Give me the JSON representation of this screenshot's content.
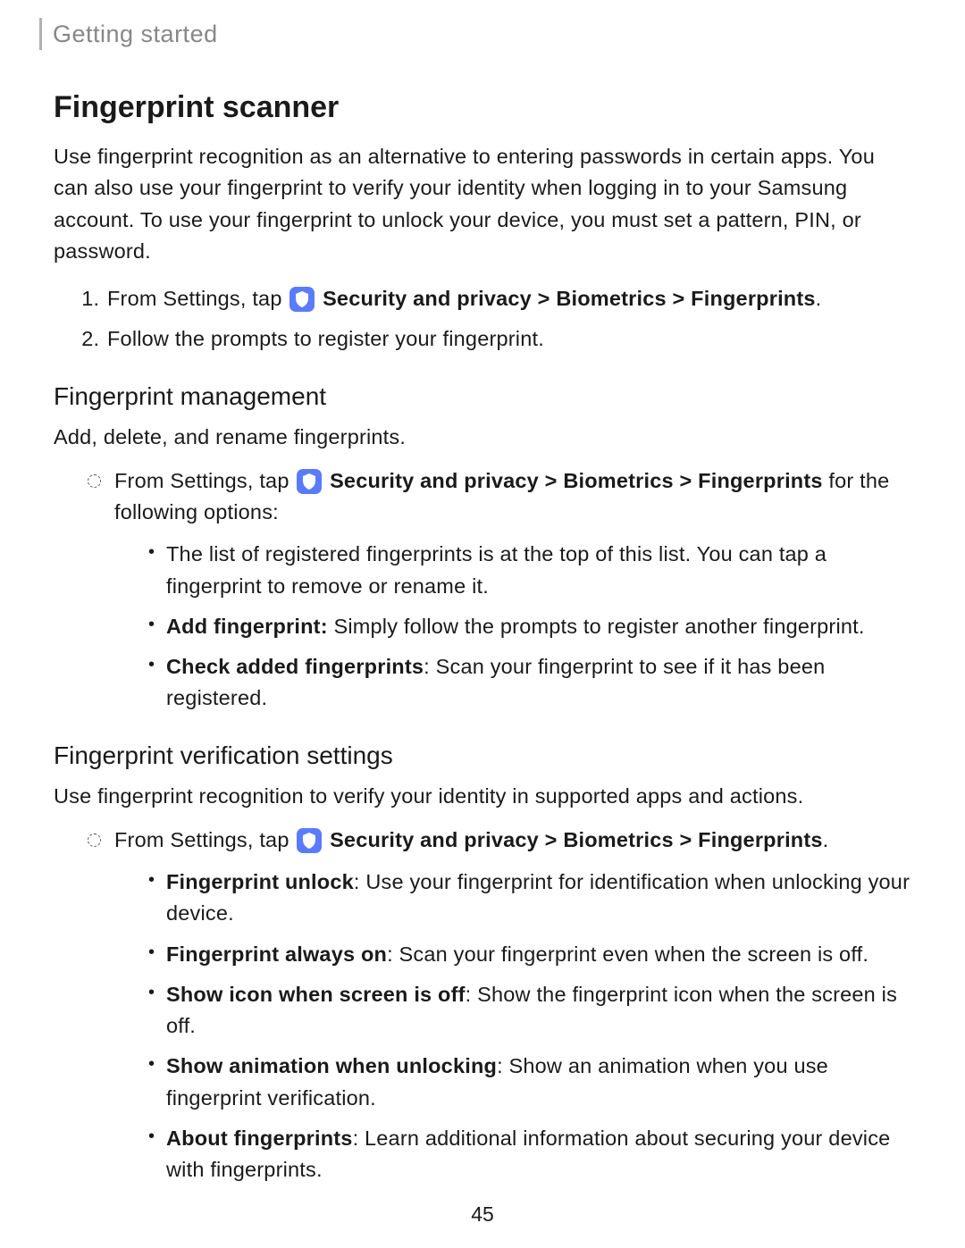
{
  "breadcrumb": "Getting started",
  "title": "Fingerprint scanner",
  "intro": "Use fingerprint recognition as an alternative to entering passwords in certain apps. You can also use your fingerprint to verify your identity when logging in to your Samsung account. To use your fingerprint to unlock your device, you must set a pattern, PIN, or password.",
  "nav_prefix": "From Settings, tap",
  "nav_path": "Security and privacy > Biometrics > Fingerprints",
  "nav_end_period": ".",
  "step2": "Follow the prompts to register your fingerprint.",
  "mgmt": {
    "heading": "Fingerprint management",
    "desc": "Add, delete, and rename fingerprints.",
    "suffix": " for the following options:",
    "bullets": {
      "b1": "The list of registered fingerprints is at the top of this list. You can tap a fingerprint to remove or rename it.",
      "b2_label": "Add fingerprint:",
      "b2_text": " Simply follow the prompts to register another fingerprint.",
      "b3_label": "Check added fingerprints",
      "b3_text": ": Scan your fingerprint to see if it has been registered."
    }
  },
  "verify": {
    "heading": "Fingerprint verification settings",
    "desc": "Use fingerprint recognition to verify your identity in supported apps and actions.",
    "bullets": {
      "b1_label": "Fingerprint unlock",
      "b1_text": ": Use your fingerprint for identification when unlocking your device.",
      "b2_label": "Fingerprint always on",
      "b2_text": ": Scan your fingerprint even when the screen is off.",
      "b3_label": "Show icon when screen is off",
      "b3_text": ": Show the fingerprint icon when the screen is off.",
      "b4_label": "Show animation when unlocking",
      "b4_text": ": Show an animation when you use fingerprint verification.",
      "b5_label": "About fingerprints",
      "b5_text": ": Learn additional information about securing your device with fingerprints."
    }
  },
  "page_number": "45"
}
